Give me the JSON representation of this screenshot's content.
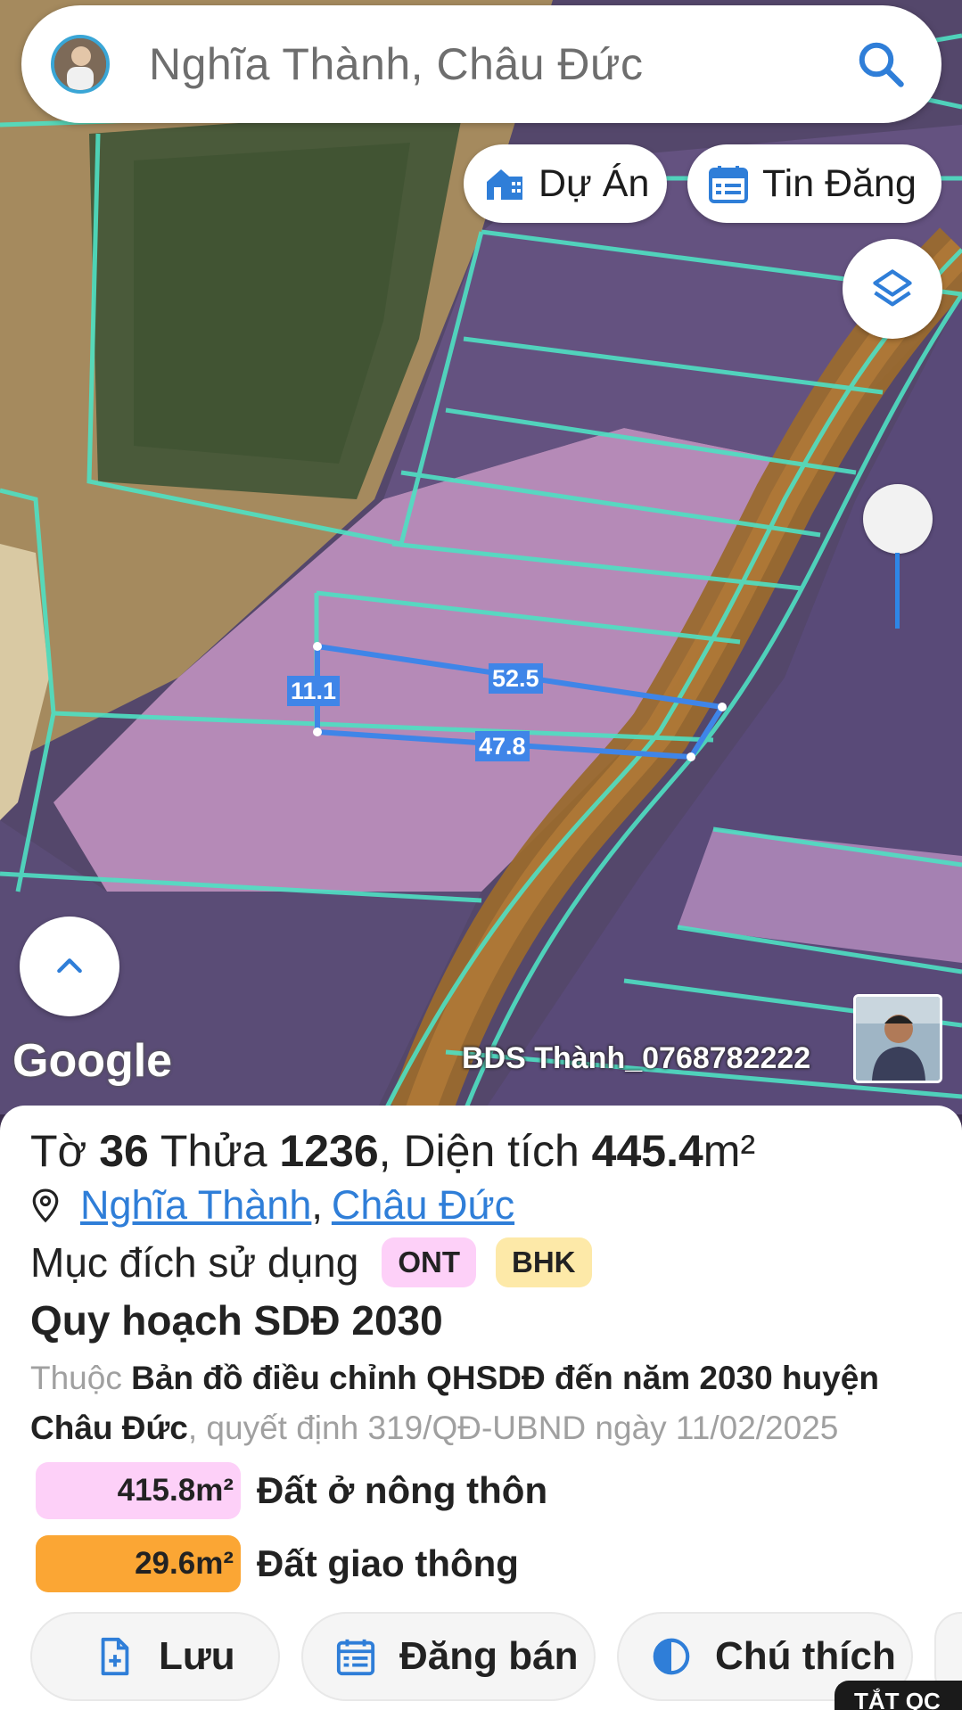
{
  "search": {
    "text": "Nghĩa Thành, Châu Đức",
    "avatar_icon": "user-avatar"
  },
  "map_buttons": {
    "du_an_label": "Dự Án",
    "tin_dang_label": "Tin Đăng"
  },
  "map": {
    "google_label": "Google",
    "watermark": "BDS Thành_0768782222",
    "dimensions": {
      "top": "52.5",
      "left": "11.1",
      "bottom": "47.8"
    }
  },
  "parcel": {
    "prefix_to": "Tờ",
    "to_number": "36",
    "prefix_thua": "Thửa",
    "thua_number": "1236",
    "area_prefix": ", Diện tích",
    "area_value": "445.4",
    "area_unit": "m²",
    "ward": "Nghĩa Thành",
    "separator": ",",
    "district": "Châu Đức",
    "usage_label": "Mục đích sử dụng",
    "usage_tags": [
      "ONT",
      "BHK"
    ]
  },
  "planning": {
    "title": "Quy hoạch SDĐ 2030",
    "desc_prefix": "Thuộc",
    "desc_strong": "Bản đồ điều chỉnh QHSDĐ đến năm 2030 huyện Châu Đức",
    "desc_suffix": ", quyết định 319/QĐ-UBND ngày 11/02/2025",
    "areas": [
      {
        "value": "415.8m²",
        "label": "Đất ở nông thôn",
        "color": "#fdd0f8"
      },
      {
        "value": "29.6m²",
        "label": "Đất giao thông",
        "color": "#fba634"
      }
    ]
  },
  "actions": {
    "save": "Lưu",
    "post": "Đăng bán",
    "legend": "Chú thích"
  },
  "corner_badge": "TẮT QC",
  "colors": {
    "accent_blue": "#2f7ed8",
    "parcel_line": "#3f85e8",
    "boundary_cyan": "#4fe0c3"
  }
}
